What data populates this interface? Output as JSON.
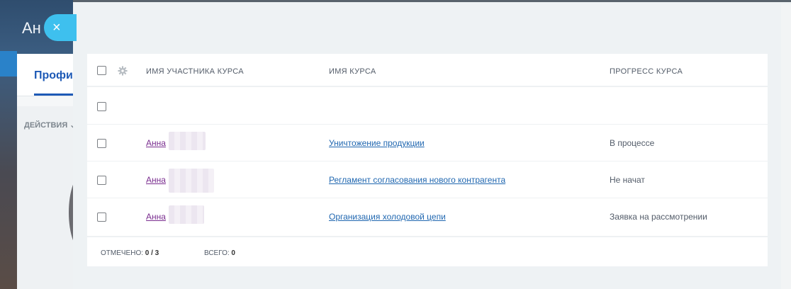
{
  "background": {
    "title": "Ан",
    "tab_label": "Профил",
    "actions_label": "ДЕЙСТВИЯ ⌄"
  },
  "close_button": {
    "icon": "close-icon",
    "glyph": "×"
  },
  "grid": {
    "columns": [
      {
        "label": "ИМЯ УЧАСТНИКА КУРСА"
      },
      {
        "label": "ИМЯ КУРСА"
      },
      {
        "label": "ПРОГРЕСС КУРСА"
      }
    ],
    "rows": [
      {
        "user": "",
        "course": "",
        "progress": ""
      },
      {
        "user": "Анна",
        "course": "Уничтожение продукции",
        "progress": "В процессе"
      },
      {
        "user": "Анна",
        "course": "Регламент согласования нового контрагента",
        "progress": "Не начат"
      },
      {
        "user": "Анна",
        "course": "Организация холодовой цепи",
        "progress": "Заявка на рассмотрении"
      }
    ],
    "footer": {
      "selected_label": "ОТМЕЧЕНО:",
      "selected_value": "0 / 3",
      "total_label": "ВСЕГО:",
      "total_value": "0"
    }
  },
  "colors": {
    "accent": "#3ec0ee",
    "link": "#2067b0",
    "visited_link": "#7a2d8f",
    "tab_blue": "#1e5ab6"
  }
}
